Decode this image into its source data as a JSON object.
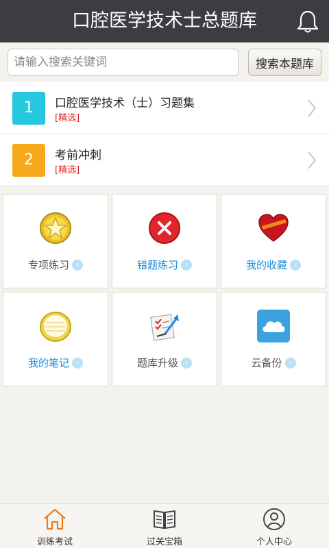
{
  "header": {
    "title": "口腔医学技术士总题库",
    "bell_icon": "bell-icon"
  },
  "search": {
    "placeholder": "请输入搜索关键词",
    "value": "",
    "button_label": "搜索本题库"
  },
  "banks": [
    {
      "number": "1",
      "name": "口腔医学技术（士）习题集",
      "tag": "[精选]",
      "color": "#25c8df"
    },
    {
      "number": "2",
      "name": "考前冲刺",
      "tag": "[精选]",
      "color": "#f7a81b"
    }
  ],
  "tiles": [
    {
      "label": "专项练习",
      "icon": "gold-star-icon",
      "label_color": "#555555"
    },
    {
      "label": "错题练习",
      "icon": "error-x-icon",
      "label_color": "#1a8ed8"
    },
    {
      "label": "我的收藏",
      "icon": "favorite-heart-icon",
      "label_color": "#1a8ed8"
    },
    {
      "label": "我的笔记",
      "icon": "notepad-icon",
      "label_color": "#1a8ed8"
    },
    {
      "label": "题库升级",
      "icon": "upgrade-checklist-icon",
      "label_color": "#555555"
    },
    {
      "label": "云备份",
      "icon": "cloud-backup-icon",
      "label_color": "#555555"
    }
  ],
  "tabs": [
    {
      "label": "训练考试",
      "icon": "home-icon",
      "active": true
    },
    {
      "label": "过关宝箱",
      "icon": "book-icon",
      "active": false
    },
    {
      "label": "个人中心",
      "icon": "user-icon",
      "active": false
    }
  ],
  "colors": {
    "accent": "#1a8ed8",
    "active_tab": "#f07a1a",
    "tag_red": "#e02020"
  }
}
